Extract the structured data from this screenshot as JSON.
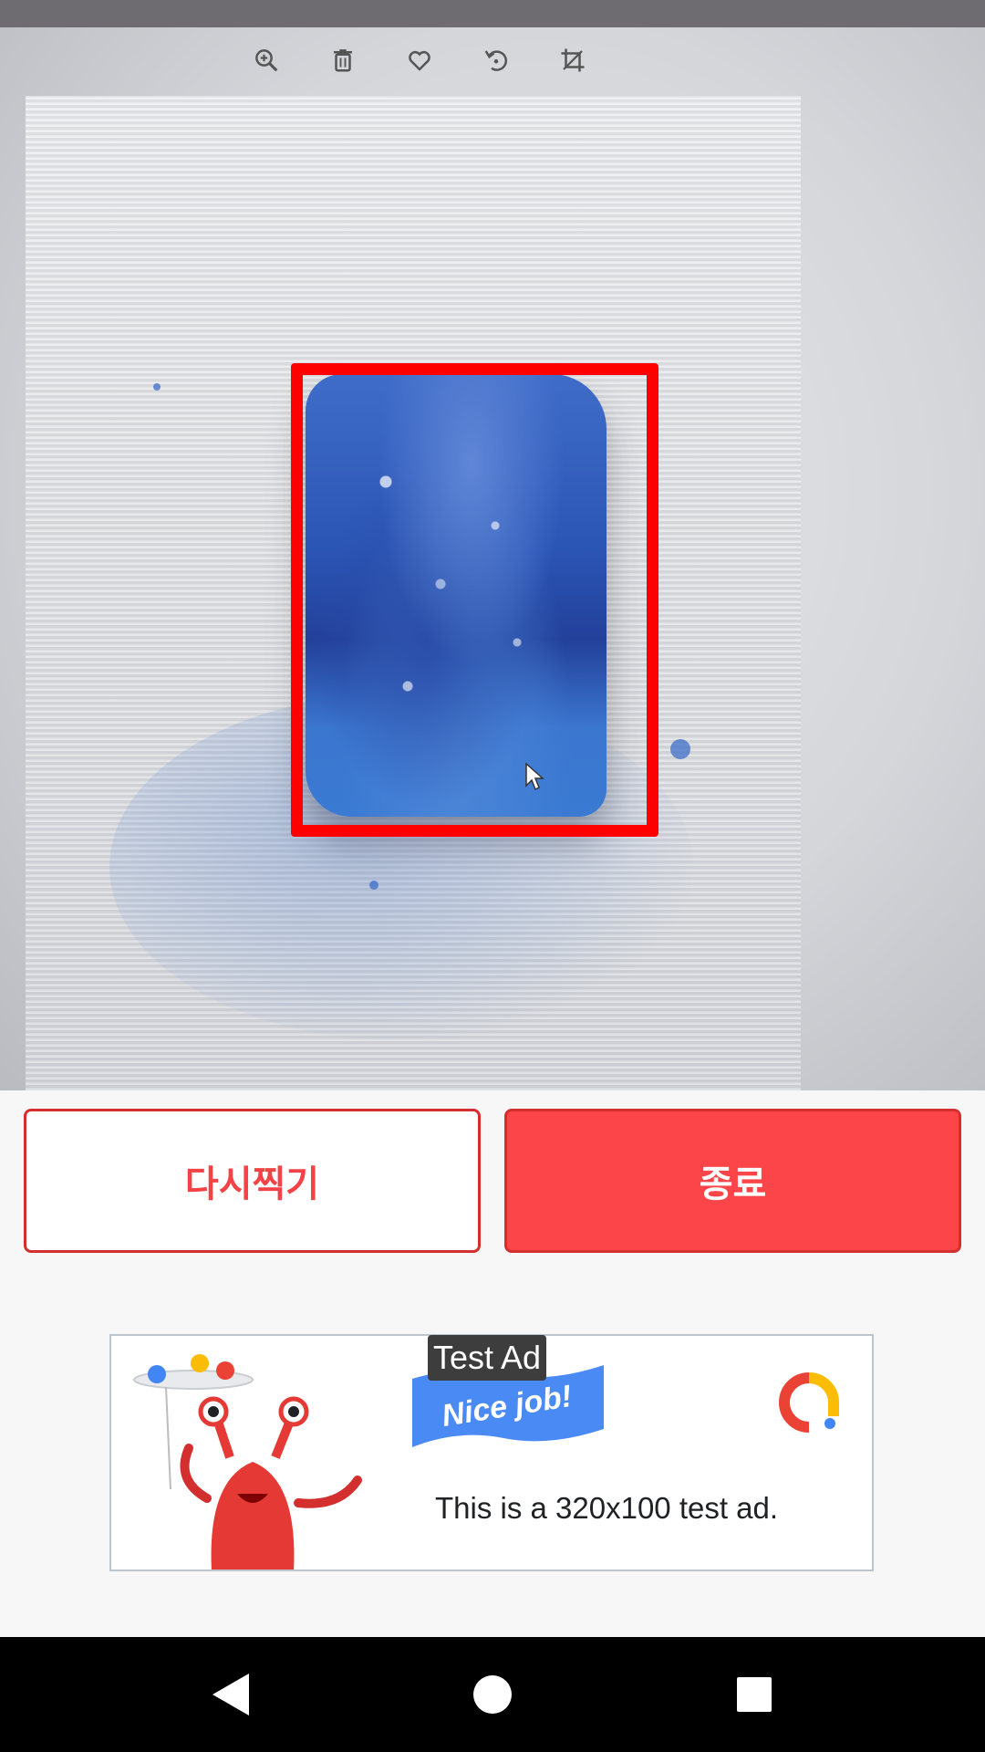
{
  "image_toolbar": {
    "icons": [
      "zoom-in-icon",
      "trash-icon",
      "heart-icon",
      "rotate-icon",
      "crop-icon"
    ]
  },
  "photo": {
    "detection_box_color": "#ff0000"
  },
  "actions": {
    "retake_label": "다시찍기",
    "exit_label": "종료",
    "accent_color": "#fc4548"
  },
  "ad": {
    "label": "Test Ad",
    "flag_text": "Nice job!",
    "body_text": "This is a 320x100 test ad."
  },
  "nav": {
    "icons": [
      "back-icon",
      "home-icon",
      "recents-icon"
    ]
  }
}
